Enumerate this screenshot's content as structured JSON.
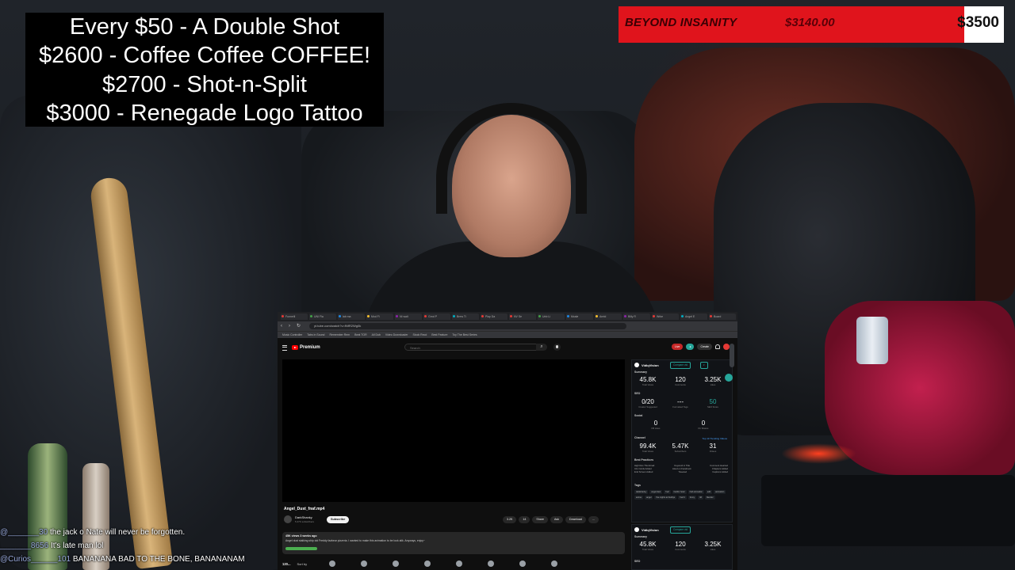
{
  "overlay": {
    "goals": [
      "Every $50 - A Double Shot",
      "$2600 - Coffee Coffee COFFEE!",
      "$2700 - Shot-n-Split",
      "$3000 - Renegade Logo Tattoo"
    ],
    "goal_bar": {
      "label": "BEYOND INSANITY",
      "current": "$3140.00",
      "target": "$3500",
      "progress_fraction": 0.897,
      "fill_color": "#e0141c"
    }
  },
  "browser": {
    "tabs": [
      "Funnelli",
      "UNI Fla",
      "lab ma",
      "Mod Fi",
      "NI wait",
      "Grnd P",
      "Brew Ti",
      "Play Da",
      "NV Se",
      "Unb Li",
      "Mcale",
      "Anrtd",
      "Billy R",
      "Wrke",
      "Angel E",
      "Board"
    ],
    "url": "yt.tube.com/watch?v=fNfR2Wg0k",
    "bookmarks": [
      "Music Controller",
      "Tabs in Sound",
      "Remember Rem",
      "Beat TOR",
      "All Dub",
      "Video Downloader",
      "Stock Recd",
      "Best Feature",
      "Toy The Best Series"
    ],
    "youtube": {
      "brand": "Premium",
      "search_placeholder": "Search",
      "create_label": "Create",
      "live_label": "Live",
      "video_title": "Angel_Dust_fnaf.mp4",
      "channel_name": "DarkShanky",
      "channel_subs": "5.47K subscribers",
      "subscribe_label": "Subscribe",
      "actions": [
        "3.2K",
        "14",
        "Share",
        "Ask",
        "Download",
        "..."
      ],
      "description_stats": "45K views 3 weeks ago",
      "description_text": "Angel dust stalking ship old Freddy fazbear pizzeria. I wanted to make this animation to be look alik. Anyways, enjoy~",
      "comments_count": "120...",
      "sort_label": "Sort by"
    },
    "vidiq": {
      "title": "VidiqVision",
      "compare_label": "Compare vid",
      "summary_label": "Summary",
      "summary_stats": [
        {
          "num": "45.8K",
          "label": "Total Views"
        },
        {
          "num": "120",
          "label": "Comments"
        },
        {
          "num": "3.25K",
          "label": "Likes"
        }
      ],
      "seo_label": "SEO",
      "seo_stats": [
        {
          "num": "0/20",
          "label": "Creator Suggested"
        },
        {
          "num": "---",
          "label": "Formatted Tags"
        },
        {
          "num": "50",
          "label": "SEO Score"
        }
      ],
      "social_label": "Social",
      "social_stats": [
        {
          "num": "0",
          "label": "FB Likes"
        },
        {
          "num": "0",
          "label": "Fb Shares"
        }
      ],
      "channel_label": "Channel",
      "channel_link": "Top 10 Trending Videos",
      "channel_stats": [
        {
          "num": "99.4K",
          "label": "Total Views"
        },
        {
          "num": "5.47K",
          "label": "Subscribers"
        },
        {
          "num": "31",
          "label": "Videos"
        }
      ],
      "best_practices_label": "Best Practices",
      "best_practices": [
        [
          "High Res Thumbnail",
          "Keyword in Title",
          "Comment Hearted"
        ],
        [
          "Info Cards Added",
          "Liked on Facebook",
          "Chapters Added"
        ],
        [
          "End Screen Added",
          "Tweeted",
          "Captions Added"
        ]
      ],
      "tags_label": "Tags",
      "tags": [
        "darkshanky",
        "angel dust",
        "fnaf",
        "hazbin hotel",
        "fnaf animation",
        "edit",
        "animation",
        "anime",
        "angel",
        "five nights at freddys",
        "fnaf 4",
        "funny",
        "3d",
        "blender"
      ]
    }
  },
  "chat": [
    {
      "user": "@_______30",
      "message": "the jack o Nate will never be forgotten."
    },
    {
      "user": "_______8656",
      "message": "It's late man lol"
    },
    {
      "user": "@Curios______101",
      "message": "BANANANA BAD TO THE BONE, BANANANAM"
    }
  ]
}
